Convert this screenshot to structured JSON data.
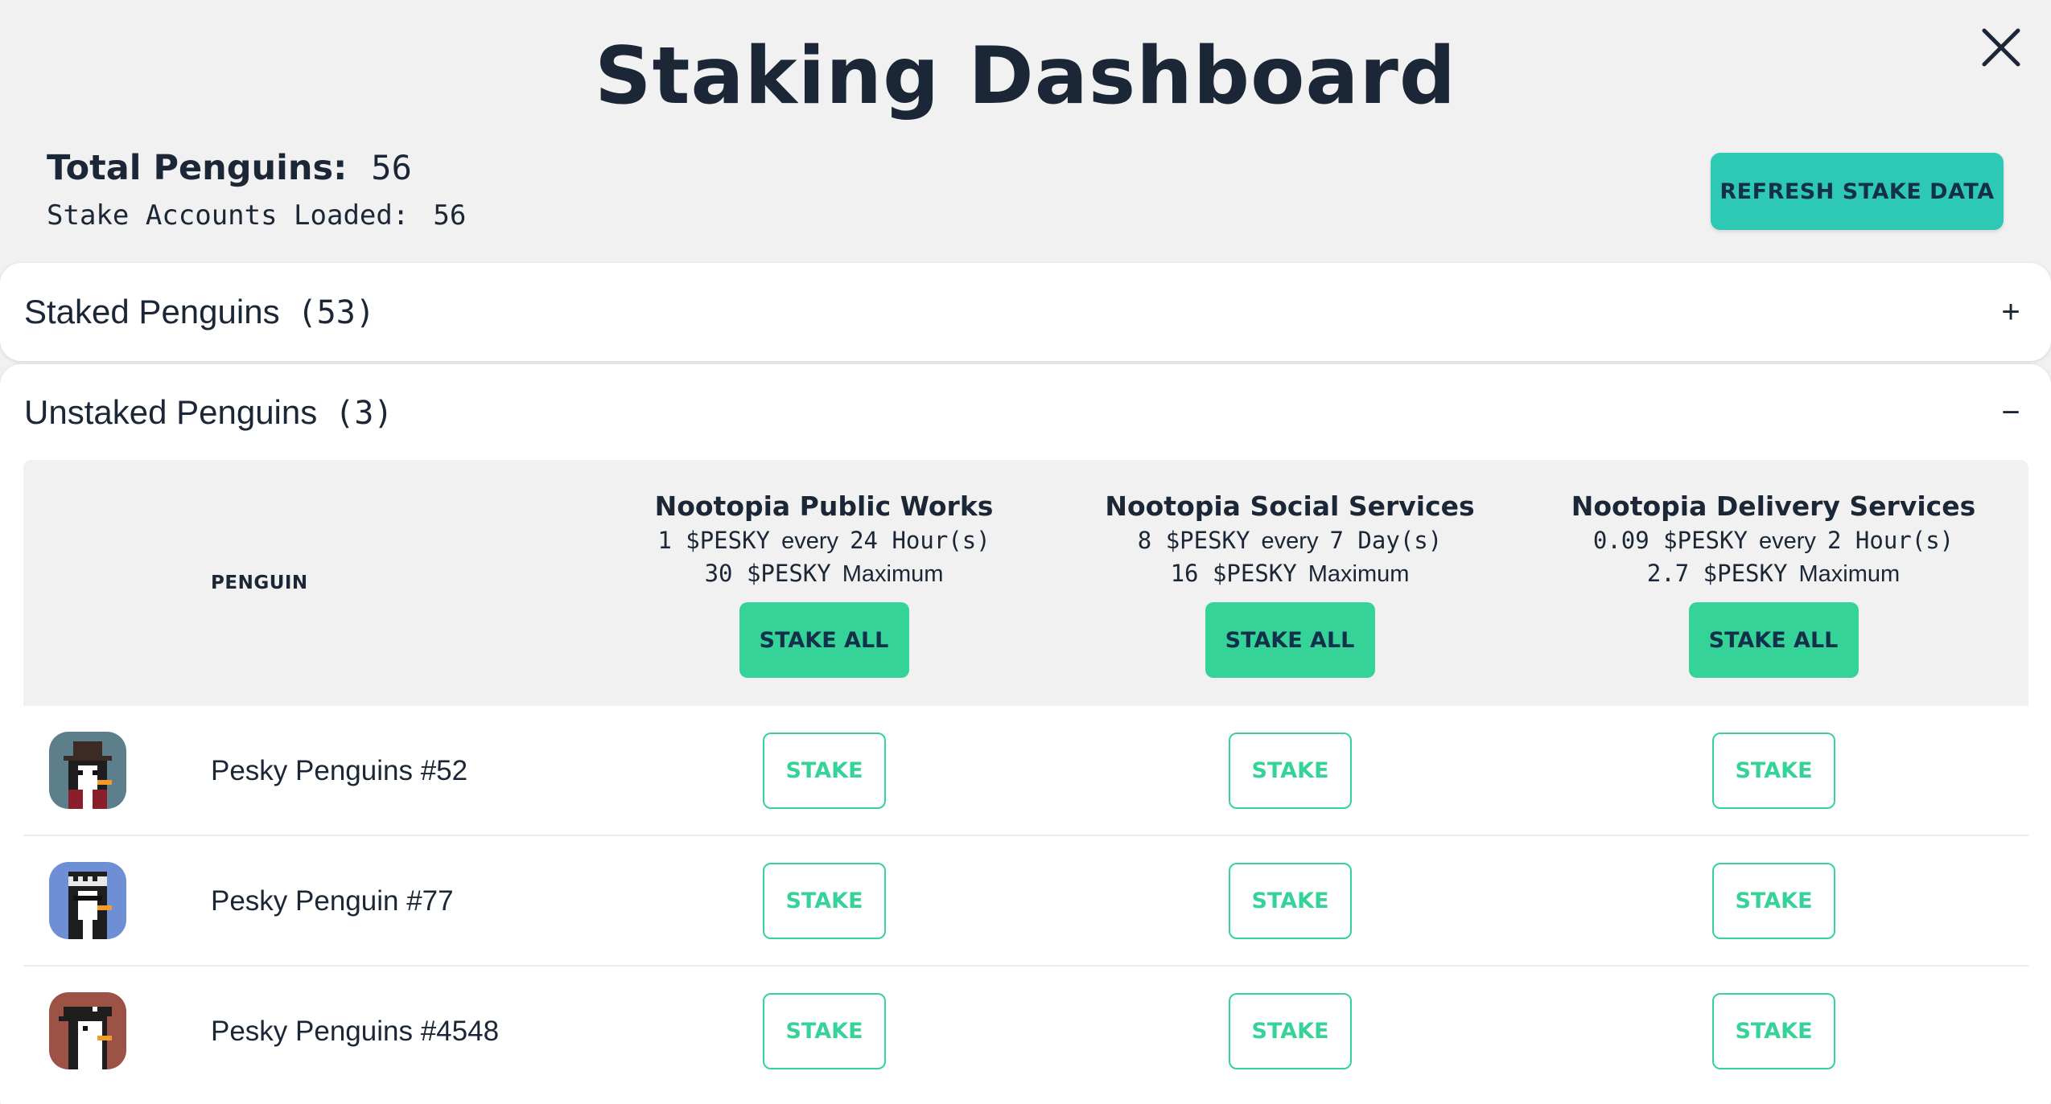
{
  "title": "Staking Dashboard",
  "summary": {
    "total_label": "Total Penguins:",
    "total_value": "56",
    "accounts_label": "Stake Accounts Loaded:",
    "accounts_value": "56"
  },
  "refresh_label": "REFRESH STAKE DATA",
  "staked": {
    "label": "Staked Penguins",
    "count": "(53)",
    "toggle": "+"
  },
  "unstaked": {
    "label": "Unstaked Penguins",
    "count": "(3)",
    "toggle": "−"
  },
  "table": {
    "penguin_header": "PENGUIN",
    "stake_all_label": "STAKE ALL",
    "stake_label": "STAKE",
    "columns": [
      {
        "name": "Nootopia Public Works",
        "reward": "1 $PESKY",
        "every": "every",
        "period": "24 Hour(s)",
        "max_amount": "30 $PESKY",
        "max_label": "Maximum"
      },
      {
        "name": "Nootopia Social Services",
        "reward": "8 $PESKY",
        "every": "every",
        "period": "7 Day(s)",
        "max_amount": "16 $PESKY",
        "max_label": "Maximum"
      },
      {
        "name": "Nootopia Delivery Services",
        "reward": "0.09 $PESKY",
        "every": "every",
        "period": "2 Hour(s)",
        "max_amount": "2.7 $PESKY",
        "max_label": "Maximum"
      }
    ],
    "rows": [
      {
        "name": "Pesky Penguins #52",
        "avatar": "penguin-witch-hat-avatar"
      },
      {
        "name": "Pesky Penguin #77",
        "avatar": "penguin-headband-sunglasses-avatar"
      },
      {
        "name": "Pesky Penguins #4548",
        "avatar": "penguin-pirate-bandana-avatar"
      }
    ]
  },
  "colors": {
    "background": "#f1f1f1",
    "refresh_button": "#2dc9b4",
    "stake_green": "#36d399",
    "text_dark": "#1b2636"
  }
}
